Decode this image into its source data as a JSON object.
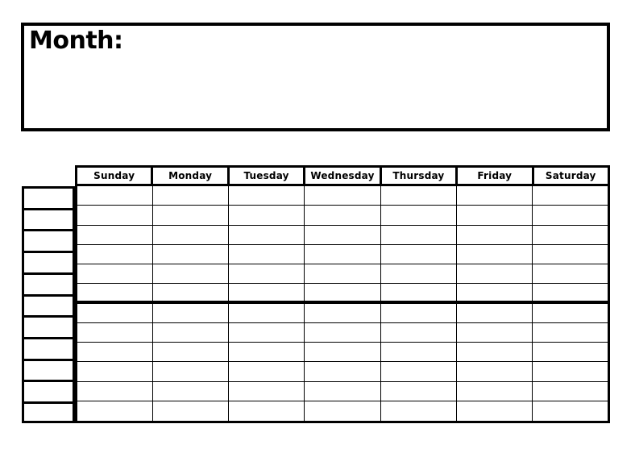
{
  "document": {
    "type": "blank-monthly-calendar-template",
    "background_color": "#ffffff",
    "line_color": "#000000"
  },
  "month_box": {
    "label": "Month:",
    "value": "",
    "placeholder": ""
  },
  "calendar": {
    "day_headers": [
      "Sunday",
      "Monday",
      "Tuesday",
      "Wednesday",
      "Thursday",
      "Friday",
      "Saturday"
    ],
    "week_label_cells": [
      "",
      "",
      "",
      "",
      "",
      "",
      "",
      "",
      "",
      "",
      ""
    ],
    "day_rows": [
      {
        "thick_under": false,
        "cells": [
          "",
          "",
          "",
          "",
          "",
          "",
          ""
        ]
      },
      {
        "thick_under": false,
        "cells": [
          "",
          "",
          "",
          "",
          "",
          "",
          ""
        ]
      },
      {
        "thick_under": false,
        "cells": [
          "",
          "",
          "",
          "",
          "",
          "",
          ""
        ]
      },
      {
        "thick_under": false,
        "cells": [
          "",
          "",
          "",
          "",
          "",
          "",
          ""
        ]
      },
      {
        "thick_under": false,
        "cells": [
          "",
          "",
          "",
          "",
          "",
          "",
          ""
        ]
      },
      {
        "thick_under": true,
        "cells": [
          "",
          "",
          "",
          "",
          "",
          "",
          ""
        ]
      },
      {
        "thick_under": false,
        "cells": [
          "",
          "",
          "",
          "",
          "",
          "",
          ""
        ]
      },
      {
        "thick_under": false,
        "cells": [
          "",
          "",
          "",
          "",
          "",
          "",
          ""
        ]
      },
      {
        "thick_under": false,
        "cells": [
          "",
          "",
          "",
          "",
          "",
          "",
          ""
        ]
      },
      {
        "thick_under": false,
        "cells": [
          "",
          "",
          "",
          "",
          "",
          "",
          ""
        ]
      },
      {
        "thick_under": false,
        "cells": [
          "",
          "",
          "",
          "",
          "",
          "",
          ""
        ]
      },
      {
        "thick_under": false,
        "cells": [
          "",
          "",
          "",
          "",
          "",
          "",
          ""
        ]
      }
    ]
  }
}
